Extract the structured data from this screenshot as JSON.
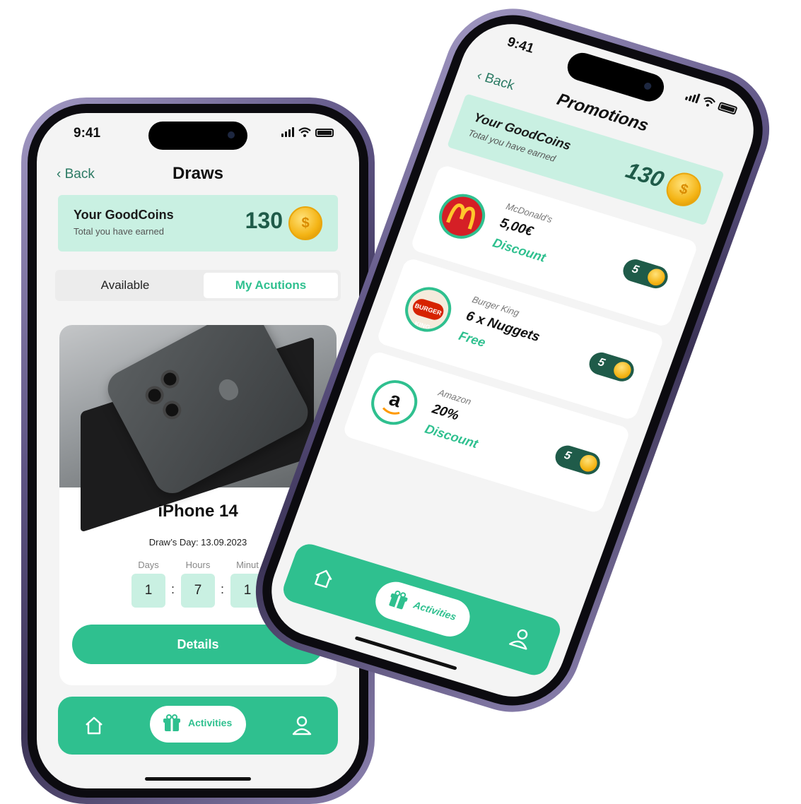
{
  "left_phone": {
    "status": {
      "time": "9:41"
    },
    "nav": {
      "back": "Back",
      "title": "Draws"
    },
    "coins": {
      "title": "Your GoodCoins",
      "subtitle": "Total you have earned",
      "value": "130"
    },
    "tabs": [
      {
        "label": "Available"
      },
      {
        "label": "My Acutions",
        "active": true
      }
    ],
    "draw": {
      "product": "iPhone 14",
      "draw_day": "Draw’s Day: 13.09.2023",
      "countdown": [
        {
          "label": "Days",
          "value": "1"
        },
        {
          "label": "Hours",
          "value": "7"
        },
        {
          "label": "Minut",
          "value": "1"
        }
      ],
      "details_button": "Details"
    },
    "bottom_nav": {
      "activities_label": "Activities"
    }
  },
  "right_phone": {
    "status": {
      "time": "9:41"
    },
    "nav": {
      "back": "Back",
      "title": "Promotions"
    },
    "coins": {
      "title": "Your GoodCoins",
      "subtitle": "Total you have earned",
      "value": "130"
    },
    "promotions": [
      {
        "brand": "McDonald's",
        "value": "5,00€",
        "type": "Discount",
        "price": "5"
      },
      {
        "brand": "Burger King",
        "value": "6 x Nuggets",
        "type": "Free",
        "price": "5",
        "logo_text": "BURGER KING"
      },
      {
        "brand": "Amazon",
        "value": "20%",
        "type": "Discount",
        "price": "5",
        "logo_text": "a"
      }
    ],
    "bottom_nav": {
      "activities_label": "Activities"
    }
  },
  "colors": {
    "accent": "#2fc08f",
    "mint": "#c9f0e2",
    "dark_green": "#1f5b49",
    "frame": "#5f5585"
  },
  "icons": [
    "back-chevron-icon",
    "coin-icon",
    "home-icon",
    "gift-icon",
    "profile-icon",
    "signal-icon",
    "wifi-icon",
    "battery-icon"
  ]
}
